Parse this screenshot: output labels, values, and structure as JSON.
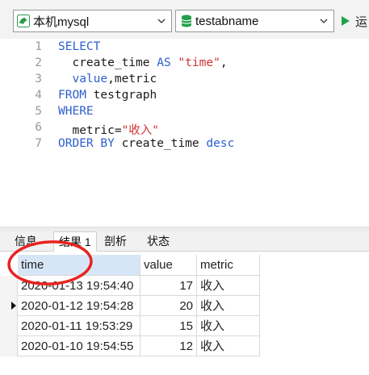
{
  "toolbar": {
    "connection": "本机mysql",
    "database": "testabname",
    "run_label": "运"
  },
  "editor": {
    "line_numbers": [
      "1",
      "2",
      "3",
      "4",
      "5",
      "6",
      "7"
    ],
    "lines": [
      [
        {
          "t": "SELECT",
          "c": "kw"
        }
      ],
      [
        {
          "t": "  create_time ",
          "c": ""
        },
        {
          "t": "AS",
          "c": "kw"
        },
        {
          "t": " ",
          "c": ""
        },
        {
          "t": "\"time\"",
          "c": "str"
        },
        {
          "t": ",",
          "c": ""
        }
      ],
      [
        {
          "t": "  ",
          "c": ""
        },
        {
          "t": "value",
          "c": "kw"
        },
        {
          "t": ",metric",
          "c": ""
        }
      ],
      [
        {
          "t": "FROM",
          "c": "kw"
        },
        {
          "t": " testgraph",
          "c": ""
        }
      ],
      [
        {
          "t": "WHERE",
          "c": "kw"
        }
      ],
      [
        {
          "t": "  metric=",
          "c": ""
        },
        {
          "t": "\"收入\"",
          "c": "str"
        }
      ],
      [
        {
          "t": "ORDER BY",
          "c": "kw"
        },
        {
          "t": " create_time ",
          "c": ""
        },
        {
          "t": "desc",
          "c": "kw"
        }
      ]
    ]
  },
  "result_tabs": [
    "信息",
    "结果 1",
    "剖析",
    "状态"
  ],
  "active_tab": "结果 1",
  "grid": {
    "columns": [
      "time",
      "value",
      "metric"
    ],
    "rows": [
      {
        "time": "2020-01-13 19:54:40",
        "value": "17",
        "metric": "收入"
      },
      {
        "time": "2020-01-12 19:54:28",
        "value": "20",
        "metric": "收入"
      },
      {
        "time": "2020-01-11 19:53:29",
        "value": "15",
        "metric": "收入"
      },
      {
        "time": "2020-01-10 19:54:55",
        "value": "12",
        "metric": "收入"
      }
    ],
    "current_row": 1
  },
  "colors": {
    "keyword": "#2d5fd0",
    "string": "#d23333",
    "header_selected": "#d6e6f7",
    "annotation": "#e8231f",
    "run": "#1fa34a",
    "db_icon": "#22a04a"
  }
}
